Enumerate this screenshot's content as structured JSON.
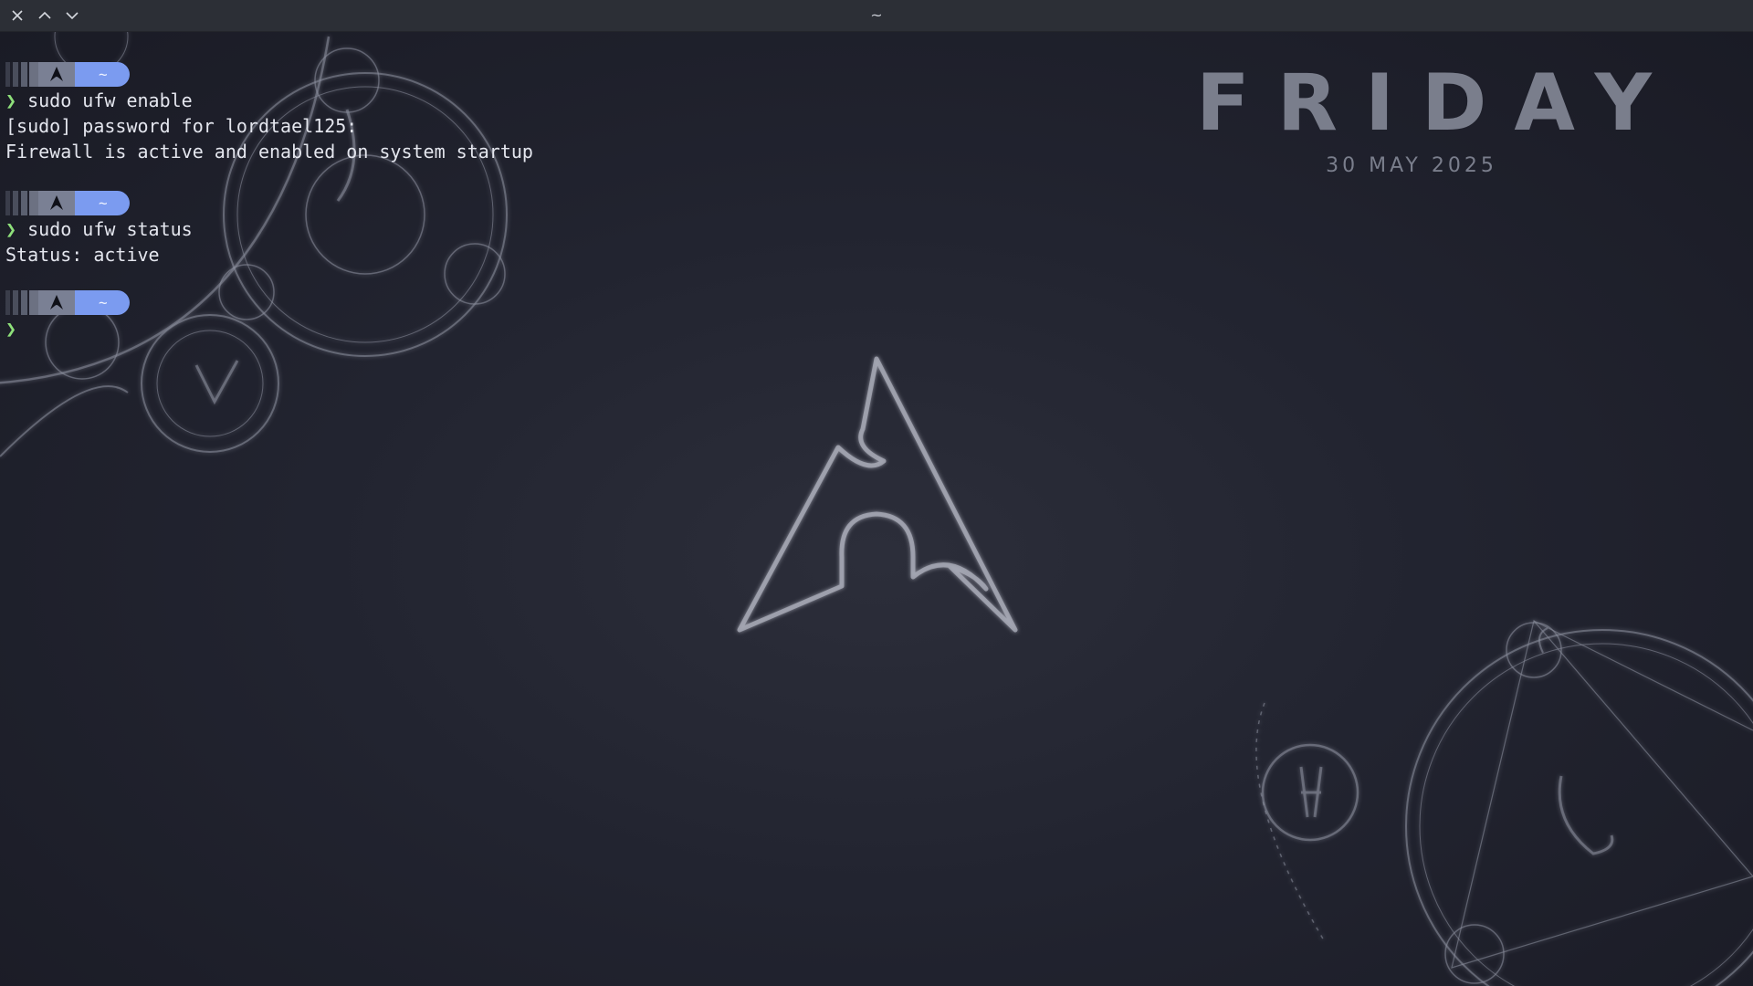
{
  "window": {
    "title": "~",
    "controls": {
      "close_icon": "close-icon",
      "maximize_icon": "chevron-up-icon",
      "minimize_icon": "chevron-down-icon"
    }
  },
  "clock": {
    "day": "FRIDAY",
    "date": "30 MAY 2025"
  },
  "prompt": {
    "symbol": "❯",
    "dir": "~",
    "os_icon": "arch-linux-icon"
  },
  "terminal": {
    "blocks": [
      {
        "command": "sudo ufw enable",
        "output": [
          "[sudo] password for lordtael125:",
          "Firewall is active and enabled on system startup"
        ]
      },
      {
        "command": "sudo ufw status",
        "output": [
          "Status: active"
        ]
      },
      {
        "command": "",
        "output": []
      }
    ]
  },
  "colors": {
    "background": "#1e1f2a",
    "titlebar": "#2c2f36",
    "prompt_accent": "#7b9bf0",
    "prompt_chevron": "#8ee07a",
    "text": "#e4e6ee",
    "clock": "#7a7e8c"
  }
}
